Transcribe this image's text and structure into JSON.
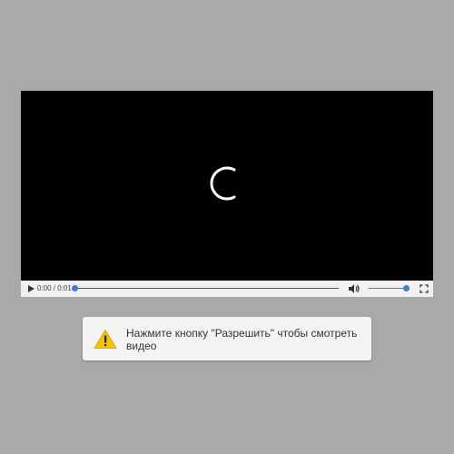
{
  "player": {
    "time_display": "0:00 / 0:01",
    "progress": 0.0,
    "volume": 1.0,
    "state": "loading"
  },
  "icons": {
    "spinner": "loading-spinner-icon",
    "play": "play-icon",
    "volume": "volume-icon",
    "fullscreen": "fullscreen-icon",
    "warning": "warning-icon"
  },
  "notice": {
    "text": "Нажмите кнопку \"Разрешить\" чтобы смотреть видео"
  },
  "colors": {
    "background": "#a9a9a9",
    "accent": "#3b7ddd",
    "warning": "#f5c400"
  }
}
